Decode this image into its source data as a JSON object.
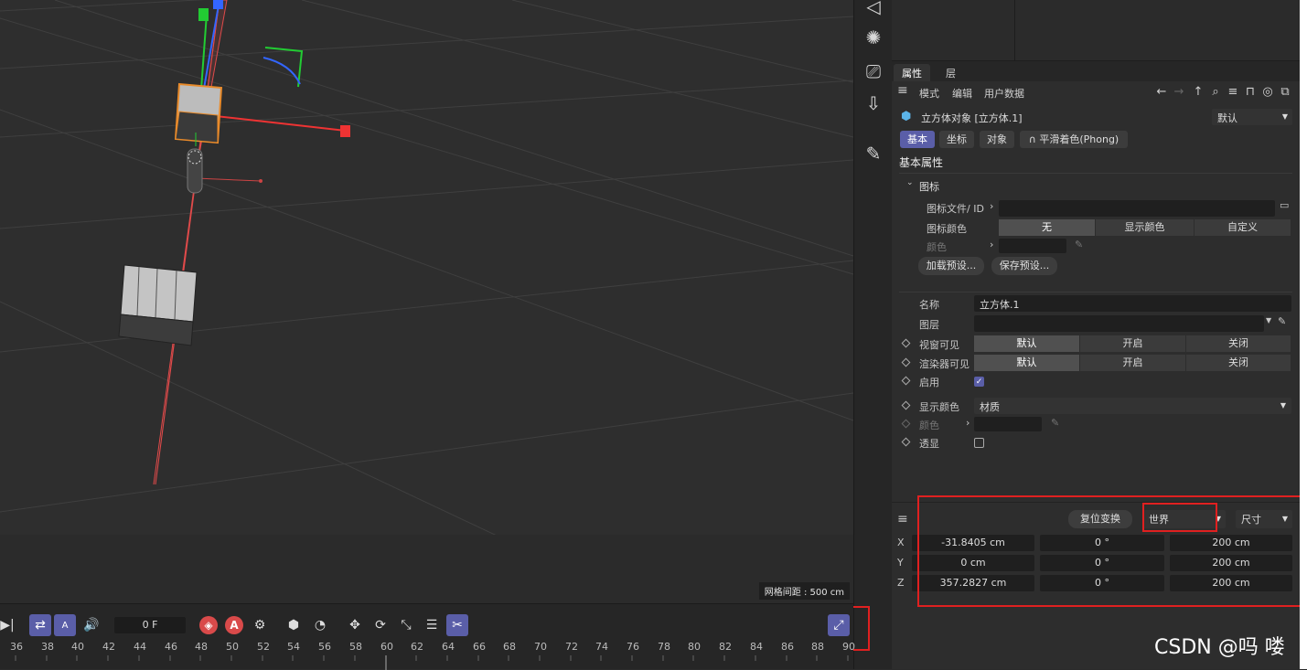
{
  "viewport": {
    "grid_spacing": "网格间距 : 500 cm"
  },
  "attributes": {
    "tabs": [
      "属性",
      "层"
    ],
    "menu": [
      "模式",
      "编辑",
      "用户数据"
    ],
    "object_title": "立方体对象 [立方体.1]",
    "preset_dropdown": "默认",
    "sub_tabs": [
      "基本",
      "坐标",
      "对象",
      "平滑着色(Phong)"
    ],
    "section_title": "基本属性",
    "icon_group": "图标",
    "icon_file_label": "图标文件/ ID",
    "icon_color_label": "图标颜色",
    "icon_color_options": [
      "无",
      "显示颜色",
      "自定义"
    ],
    "color_label": "颜色",
    "load_preset": "加载预设...",
    "save_preset": "保存预设...",
    "name_label": "名称",
    "name_value": "立方体.1",
    "layer_label": "图层",
    "viewport_visible_label": "视窗可见",
    "render_visible_label": "渲染器可见",
    "visibility_options": [
      "默认",
      "开启",
      "关闭"
    ],
    "enable_label": "启用",
    "display_color_label": "显示颜色",
    "display_color_value": "材质",
    "color2_label": "颜色",
    "xray_label": "透显"
  },
  "coordinates": {
    "reset_button": "复位变换",
    "space_dropdown": "世界",
    "size_dropdown": "尺寸",
    "rows": [
      {
        "axis": "X",
        "position": "-31.8405 cm",
        "rotation": "0 °",
        "size": "200 cm"
      },
      {
        "axis": "Y",
        "position": "0 cm",
        "rotation": "0 °",
        "size": "200 cm"
      },
      {
        "axis": "Z",
        "position": "357.2827 cm",
        "rotation": "0 °",
        "size": "200 cm"
      }
    ]
  },
  "timeline": {
    "current_frame": "0 F",
    "ticks": [
      "36",
      "38",
      "40",
      "42",
      "44",
      "46",
      "48",
      "50",
      "52",
      "54",
      "56",
      "58",
      "60",
      "62",
      "64",
      "66",
      "68",
      "70",
      "72",
      "74",
      "76",
      "78",
      "80",
      "82",
      "84",
      "86",
      "88",
      "90"
    ]
  },
  "watermark": "CSDN @吗 喽",
  "colors": {
    "accent": "#5a5ea8",
    "highlight_box": "#e02020",
    "record": "#d94a4a"
  }
}
